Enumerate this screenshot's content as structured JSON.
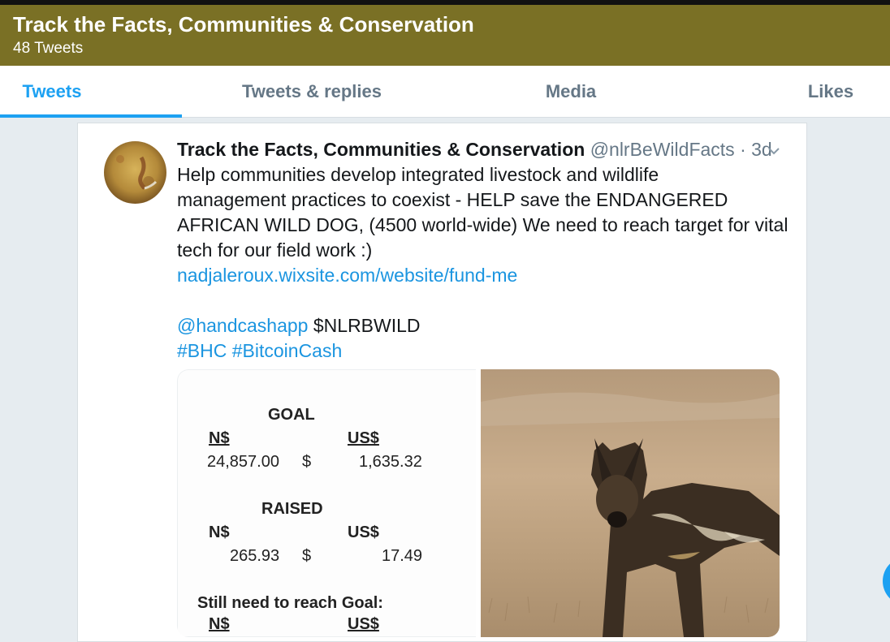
{
  "profile": {
    "name": "Track the Facts, Communities & Conservation",
    "tweet_count": "48 Tweets"
  },
  "tabs": [
    {
      "label": "Tweets",
      "active": true
    },
    {
      "label": "Tweets & replies",
      "active": false
    },
    {
      "label": "Media",
      "active": false
    },
    {
      "label": "Likes",
      "active": false
    }
  ],
  "tweet": {
    "author_name": "Track the Facts, Communities & Conservation",
    "handle": "@nlrBeWildFacts",
    "separator": "·",
    "time": "3d",
    "menu_icon": "chevron-down-icon",
    "text_lines": [
      "Help communities develop integrated livestock and wildlife",
      "management practices to coexist - HELP save the ENDANGERED",
      "AFRICAN WILD DOG, (4500 world-wide) We need to reach target for vital",
      "tech for our field work :)"
    ],
    "link": "nadjaleroux.wixsite.com/website/fund-me",
    "mention": "@handcashapp",
    "cashtag": "$NLRBWILD",
    "hashtag1": "#BHC",
    "hashtag2": "#BitcoinCash",
    "fund_card": {
      "goal_heading": "GOAL",
      "ns_label": "N$",
      "us_label": "US$",
      "goal_ns": "24,857.00",
      "goal_dollar": "$",
      "goal_us": "1,635.32",
      "raised_heading": "RAISED",
      "raised_ns": "265.93",
      "raised_dollar": "$",
      "raised_us": "17.49",
      "still_heading": "Still need to reach Goal:",
      "still_ns_label": "N$",
      "still_us_label": "US$"
    }
  },
  "colors": {
    "header_bg": "#7a7025",
    "accent": "#1da1f2",
    "link": "#1b95e0"
  }
}
